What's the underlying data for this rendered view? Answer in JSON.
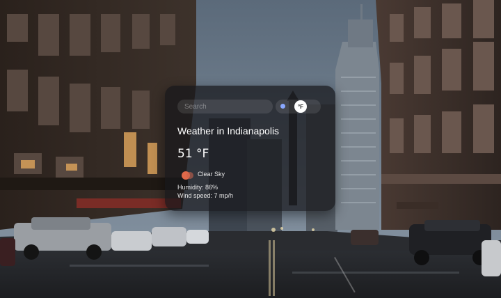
{
  "widget": {
    "search": {
      "placeholder": "Search",
      "value": ""
    },
    "unit_toggle": {
      "label": "°F"
    },
    "city_title": "Weather in Indianapolis",
    "temperature": "51 °F",
    "condition": "Clear Sky",
    "humidity": "Humidity: 86%",
    "wind": "Wind speed: 7 mp/h"
  },
  "colors": {
    "card_bg": "#16161a",
    "accent_dot": "#8aa8ff",
    "sun_icon": "#e0694a"
  },
  "icons": [
    "weather-sun-icon"
  ]
}
